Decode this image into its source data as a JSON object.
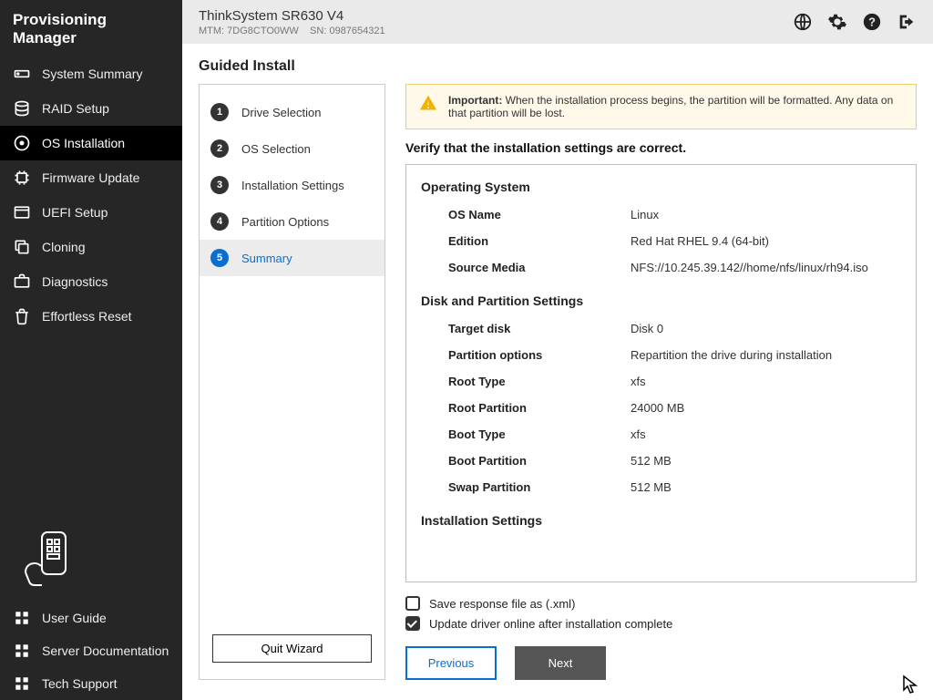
{
  "brand": "Provisioning Manager",
  "system": {
    "name": "ThinkSystem SR630 V4",
    "mtm_label": "MTM:",
    "mtm": "7DG8CTO0WW",
    "sn_label": "SN:",
    "sn": "0987654321"
  },
  "sidebar": {
    "items": [
      {
        "label": "System Summary",
        "icon": "drive"
      },
      {
        "label": "RAID Setup",
        "icon": "disks"
      },
      {
        "label": "OS Installation",
        "icon": "disc",
        "active": true
      },
      {
        "label": "Firmware Update",
        "icon": "chip"
      },
      {
        "label": "UEFI Setup",
        "icon": "window"
      },
      {
        "label": "Cloning",
        "icon": "copy"
      },
      {
        "label": "Diagnostics",
        "icon": "case"
      },
      {
        "label": "Effortless Reset",
        "icon": "trash"
      }
    ],
    "bottom": [
      {
        "label": "User Guide"
      },
      {
        "label": "Server Documentation"
      },
      {
        "label": "Tech Support"
      }
    ]
  },
  "page": {
    "title": "Guided Install",
    "steps": [
      {
        "num": "1",
        "label": "Drive Selection"
      },
      {
        "num": "2",
        "label": "OS Selection"
      },
      {
        "num": "3",
        "label": "Installation Settings"
      },
      {
        "num": "4",
        "label": "Partition Options"
      },
      {
        "num": "5",
        "label": "Summary",
        "active": true
      }
    ],
    "quit": "Quit Wizard",
    "alert_strong": "Important:",
    "alert_text": "When the installation process begins, the partition will be formatted.  Any data on that partition will be lost.",
    "verify": "Verify that the installation settings are correct.",
    "sections": {
      "os": {
        "head": "Operating System",
        "rows": [
          {
            "k": "OS Name",
            "v": "Linux"
          },
          {
            "k": "Edition",
            "v": "Red Hat RHEL 9.4 (64-bit)"
          },
          {
            "k": "Source Media",
            "v": "NFS://10.245.39.142//home/nfs/linux/rh94.iso"
          }
        ]
      },
      "disk": {
        "head": "Disk and Partition Settings",
        "rows": [
          {
            "k": "Target disk",
            "v": "Disk 0"
          },
          {
            "k": "Partition options",
            "v": "Repartition the drive during installation"
          },
          {
            "k": "Root Type",
            "v": "xfs"
          },
          {
            "k": "Root Partition",
            "v": "24000 MB"
          },
          {
            "k": "Boot Type",
            "v": "xfs"
          },
          {
            "k": "Boot Partition",
            "v": "512 MB"
          },
          {
            "k": "Swap Partition",
            "v": "512 MB"
          }
        ]
      },
      "inst": {
        "head": "Installation Settings"
      }
    },
    "chk_save": "Save response file as (.xml)",
    "chk_update": "Update driver online after installation complete",
    "btn_prev": "Previous",
    "btn_next": "Next"
  }
}
